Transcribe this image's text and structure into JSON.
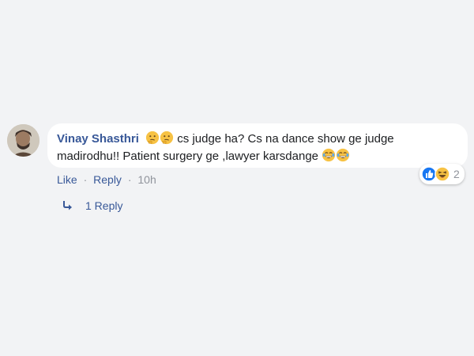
{
  "comment": {
    "author": "Vinay Shasthri",
    "text_line1": "cs judge ha? Cs na dance show ge judge",
    "text_line2": "madirodhu!! Patient surgery ge ,lawyer karsdange",
    "leading_emojis": [
      "thinking-face-icon",
      "thinking-face-icon"
    ],
    "trailing_emojis": [
      "laughing-face-icon",
      "laughing-face-icon"
    ]
  },
  "actions": {
    "like": "Like",
    "reply": "Reply",
    "time": "10h",
    "separator": "·"
  },
  "reactions": {
    "icons": [
      "like-reaction-icon",
      "haha-reaction-icon"
    ],
    "count": "2"
  },
  "replies": {
    "label": "1 Reply"
  },
  "colors": {
    "background": "#f2f3f5",
    "bubble": "#ffffff",
    "author": "#385898",
    "link": "#385898",
    "meta": "#90949c",
    "like_blue": "#1877f2",
    "emoji_yellow": "#f7c244"
  }
}
